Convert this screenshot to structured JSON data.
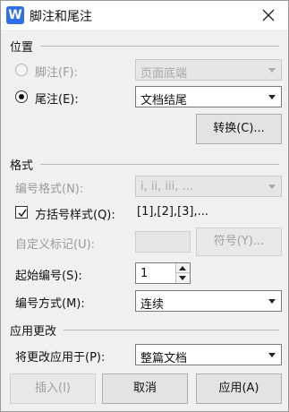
{
  "window": {
    "title": "脚注和尾注",
    "app_icon_letter": "W",
    "icon": "close-icon"
  },
  "location": {
    "section_title": "位置",
    "footnote_label": "脚注(F):",
    "footnote_value": "页面底端",
    "endnote_label": "尾注(E):",
    "endnote_value": "文档结尾",
    "convert_button": "转换(C)..."
  },
  "format": {
    "section_title": "格式",
    "number_format_label": "编号格式(N):",
    "number_format_value": "i, ii, iii, ...",
    "bracket_style_label": "方括号样式(Q):",
    "bracket_style_value": "[1],[2],[3],...",
    "custom_mark_label": "自定义标记(U):",
    "custom_mark_value": "",
    "symbol_button": "符号(Y)...",
    "start_number_label": "起始编号(S):",
    "start_number_value": "1",
    "numbering_label": "编号方式(M):",
    "numbering_value": "连续"
  },
  "apply_changes": {
    "section_title": "应用更改",
    "apply_to_label": "将更改应用于(P):",
    "apply_to_value": "整篇文档"
  },
  "footer": {
    "insert_button": "插入(I)",
    "cancel_button": "取消",
    "apply_button": "应用(A)"
  },
  "colors": {
    "accent": "#2f6fe8",
    "dialog_bg": "#f0f0f0",
    "disabled_text": "#9a9a9a"
  }
}
